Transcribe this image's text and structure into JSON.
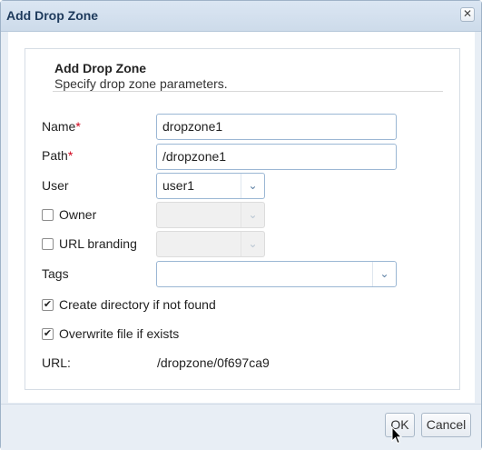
{
  "dialog": {
    "title": "Add Drop Zone",
    "close_glyph": "✕",
    "header_title": "Add Drop Zone",
    "header_subtitle": "Specify drop zone parameters."
  },
  "form": {
    "name_label": "Name",
    "name_value": "dropzone1",
    "path_label": "Path",
    "path_value": "/dropzone1",
    "required_mark": "*",
    "user_label": "User",
    "user_value": "user1",
    "owner_label": "Owner",
    "owner_checked": false,
    "owner_value": "",
    "url_branding_label": "URL branding",
    "url_branding_checked": false,
    "url_branding_value": "",
    "tags_label": "Tags",
    "tags_value": "",
    "create_dir_label": "Create directory if not found",
    "create_dir_checked": true,
    "overwrite_label": "Overwrite file if exists",
    "overwrite_checked": true,
    "url_label": "URL:",
    "url_value": "/dropzone/0f697ca9",
    "check_glyph": "✔",
    "chevron_glyph": "⌄"
  },
  "footer": {
    "ok_label": "OK",
    "cancel_label": "Cancel"
  },
  "colors": {
    "accent": "#9bb7d4",
    "required": "#d0021b",
    "title_text": "#1e3a5c"
  }
}
